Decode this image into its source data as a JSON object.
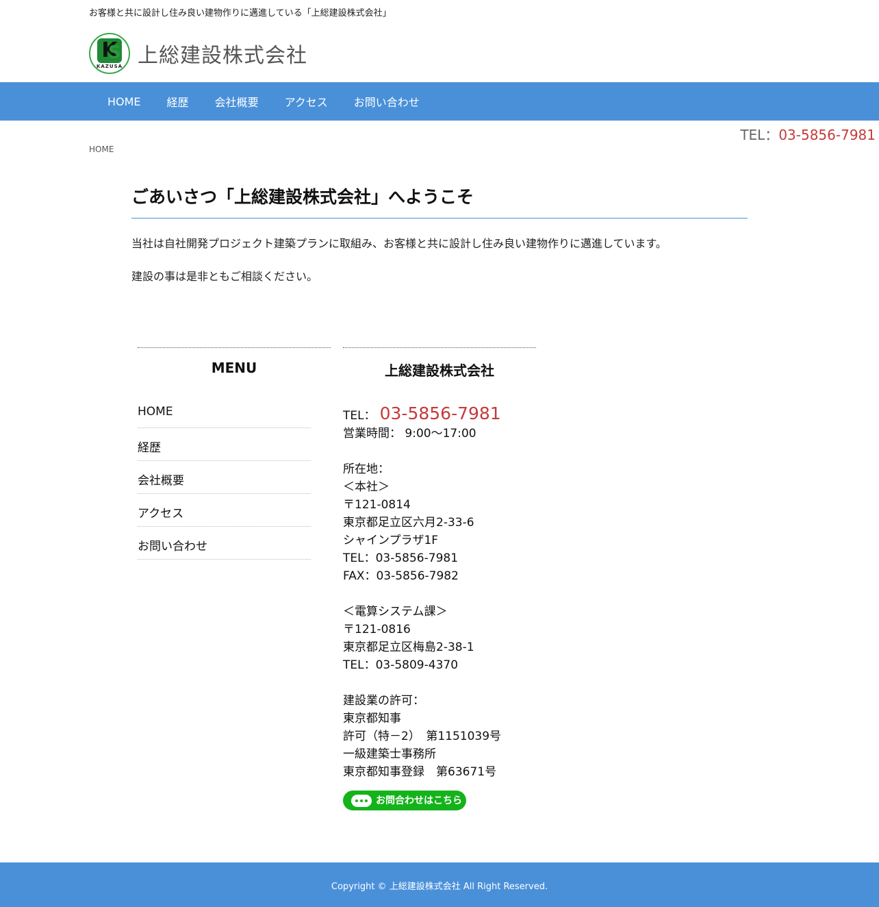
{
  "header": {
    "tagline": "お客様と共に設計し住み良い建物作りに邁進している「上総建設株式会社」",
    "site_title": "上総建設株式会社",
    "logo_text": "KAZUSA"
  },
  "nav": {
    "items": [
      "HOME",
      "経歴",
      "会社概要",
      "アクセス",
      "お問い合わせ"
    ]
  },
  "top_tel": {
    "label": "TEL：",
    "number": "03-5856-7981"
  },
  "breadcrumb": "HOME",
  "main": {
    "title": "ごあいさつ「上総建設株式会社」へようこそ",
    "paragraph1": "当社は自社開発プロジェクト建築プランに取組み、お客様と共に設計し住み良い建物作りに邁進しています。",
    "paragraph2": "建設の事は是非ともご相談ください。"
  },
  "menu": {
    "heading": "MENU",
    "items": [
      "HOME",
      "経歴",
      "会社概要",
      "アクセス",
      "お問い合わせ"
    ]
  },
  "info": {
    "heading": "上総建設株式会社",
    "tel_label": "TEL：",
    "tel_number": "03-5856-7981",
    "hours": "営業時間： 9:00～17:00",
    "address_label": "所在地：",
    "hq_label": "＜本社＞",
    "hq_zip": "〒121-0814",
    "hq_address": "東京都足立区六月2-33-6",
    "hq_building": "シャインプラザ1F",
    "hq_tel": "TEL：03-5856-7981",
    "hq_fax": "FAX：03-5856-7982",
    "branch_label": "＜電算システム課＞",
    "branch_zip": "〒121-0816",
    "branch_address": "東京都足立区梅島2-38-1",
    "branch_tel": "TEL：03-5809-4370",
    "license_label": "建設業の許可：",
    "license_authority": "東京都知事",
    "license_number": "許可（特－2）　第1151039号",
    "office_type": "一級建築士事務所",
    "office_registration": "東京都知事登録　第63671号",
    "contact_button": "お問合わせはこちら"
  },
  "footer": {
    "copyright": "Copyright © 上総建設株式会社 All Right Reserved."
  },
  "colors": {
    "accent_blue": "#4a90d9",
    "tel_red": "#c53a3a",
    "button_green": "#14b31a"
  }
}
